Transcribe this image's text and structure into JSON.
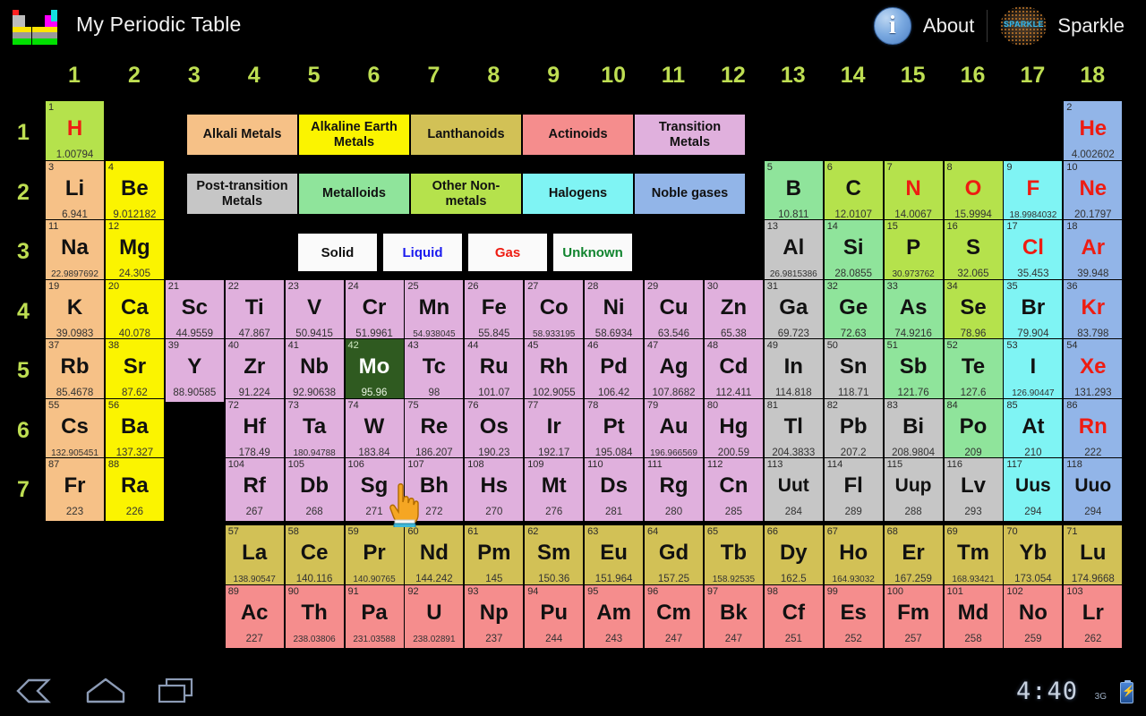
{
  "titlebar": {
    "app_title": "My Periodic Table",
    "about_label": "About",
    "sparkle_label": "Sparkle",
    "sparkle_mark": "SPARKLE",
    "info_icon": "info-icon"
  },
  "groups": [
    "1",
    "2",
    "3",
    "4",
    "5",
    "6",
    "7",
    "8",
    "9",
    "10",
    "11",
    "12",
    "13",
    "14",
    "15",
    "16",
    "17",
    "18"
  ],
  "periods": [
    "1",
    "2",
    "3",
    "4",
    "5",
    "6",
    "7"
  ],
  "colors": {
    "alkali_metals": "#f6c187",
    "alkaline_earth_metals": "#fbf400",
    "lanthanoids": "#d2c156",
    "actinoids": "#f58d8d",
    "transition_metals": "#e0b0dd",
    "post_transition_metals": "#c6c6c6",
    "metalloids": "#8fe49b",
    "other_nonmetals": "#b5e24c",
    "halogens": "#7ff4f4",
    "noble_gases": "#92b5e8",
    "selected": "#2f5a20",
    "gas_text": "#ee1c12",
    "liquid_text": "#1b1bef",
    "unknown_text": "#11842f",
    "solid_text": "#111111",
    "group_label": "#bede52",
    "background": "#000000"
  },
  "legend": {
    "categories": [
      {
        "label": "Alkali Metals",
        "key": "alkali_metals"
      },
      {
        "label": "Alkaline Earth Metals",
        "key": "alkaline_earth_metals"
      },
      {
        "label": "Lanthanoids",
        "key": "lanthanoids"
      },
      {
        "label": "Actinoids",
        "key": "actinoids"
      },
      {
        "label": "Transition Metals",
        "key": "transition_metals"
      },
      {
        "label": "Post-transition Metals",
        "key": "post_transition_metals"
      },
      {
        "label": "Metalloids",
        "key": "metalloids"
      },
      {
        "label": "Other Non-metals",
        "key": "other_nonmetals"
      },
      {
        "label": "Halogens",
        "key": "halogens"
      },
      {
        "label": "Noble gases",
        "key": "noble_gases"
      }
    ],
    "states": [
      {
        "label": "Solid",
        "color": "#111111"
      },
      {
        "label": "Liquid",
        "color": "#1b1bef"
      },
      {
        "label": "Gas",
        "color": "#ee1c12"
      },
      {
        "label": "Unknown",
        "color": "#11842f"
      }
    ]
  },
  "selected_element": "Mo",
  "elements": [
    {
      "n": "1",
      "s": "H",
      "m": "1.00794",
      "g": 1,
      "p": 1,
      "cat": "other_nonmetals",
      "st": "gas"
    },
    {
      "n": "2",
      "s": "He",
      "m": "4.002602",
      "g": 18,
      "p": 1,
      "cat": "noble_gases",
      "st": "gas"
    },
    {
      "n": "3",
      "s": "Li",
      "m": "6.941",
      "g": 1,
      "p": 2,
      "cat": "alkali_metals",
      "st": "solid"
    },
    {
      "n": "4",
      "s": "Be",
      "m": "9.012182",
      "g": 2,
      "p": 2,
      "cat": "alkaline_earth_metals",
      "st": "solid"
    },
    {
      "n": "5",
      "s": "B",
      "m": "10.811",
      "g": 13,
      "p": 2,
      "cat": "metalloids",
      "st": "solid"
    },
    {
      "n": "6",
      "s": "C",
      "m": "12.0107",
      "g": 14,
      "p": 2,
      "cat": "other_nonmetals",
      "st": "solid"
    },
    {
      "n": "7",
      "s": "N",
      "m": "14.0067",
      "g": 15,
      "p": 2,
      "cat": "other_nonmetals",
      "st": "gas"
    },
    {
      "n": "8",
      "s": "O",
      "m": "15.9994",
      "g": 16,
      "p": 2,
      "cat": "other_nonmetals",
      "st": "gas"
    },
    {
      "n": "9",
      "s": "F",
      "m": "18.9984032",
      "g": 17,
      "p": 2,
      "cat": "halogens",
      "st": "gas"
    },
    {
      "n": "10",
      "s": "Ne",
      "m": "20.1797",
      "g": 18,
      "p": 2,
      "cat": "noble_gases",
      "st": "gas"
    },
    {
      "n": "11",
      "s": "Na",
      "m": "22.9897692",
      "g": 1,
      "p": 3,
      "cat": "alkali_metals",
      "st": "solid"
    },
    {
      "n": "12",
      "s": "Mg",
      "m": "24.305",
      "g": 2,
      "p": 3,
      "cat": "alkaline_earth_metals",
      "st": "solid"
    },
    {
      "n": "13",
      "s": "Al",
      "m": "26.9815386",
      "g": 13,
      "p": 3,
      "cat": "post_transition_metals",
      "st": "solid"
    },
    {
      "n": "14",
      "s": "Si",
      "m": "28.0855",
      "g": 14,
      "p": 3,
      "cat": "metalloids",
      "st": "solid"
    },
    {
      "n": "15",
      "s": "P",
      "m": "30.973762",
      "g": 15,
      "p": 3,
      "cat": "other_nonmetals",
      "st": "solid"
    },
    {
      "n": "16",
      "s": "S",
      "m": "32.065",
      "g": 16,
      "p": 3,
      "cat": "other_nonmetals",
      "st": "solid"
    },
    {
      "n": "17",
      "s": "Cl",
      "m": "35.453",
      "g": 17,
      "p": 3,
      "cat": "halogens",
      "st": "gas"
    },
    {
      "n": "18",
      "s": "Ar",
      "m": "39.948",
      "g": 18,
      "p": 3,
      "cat": "noble_gases",
      "st": "gas"
    },
    {
      "n": "19",
      "s": "K",
      "m": "39.0983",
      "g": 1,
      "p": 4,
      "cat": "alkali_metals",
      "st": "solid"
    },
    {
      "n": "20",
      "s": "Ca",
      "m": "40.078",
      "g": 2,
      "p": 4,
      "cat": "alkaline_earth_metals",
      "st": "solid"
    },
    {
      "n": "21",
      "s": "Sc",
      "m": "44.9559",
      "g": 3,
      "p": 4,
      "cat": "transition_metals",
      "st": "solid"
    },
    {
      "n": "22",
      "s": "Ti",
      "m": "47.867",
      "g": 4,
      "p": 4,
      "cat": "transition_metals",
      "st": "solid"
    },
    {
      "n": "23",
      "s": "V",
      "m": "50.9415",
      "g": 5,
      "p": 4,
      "cat": "transition_metals",
      "st": "solid"
    },
    {
      "n": "24",
      "s": "Cr",
      "m": "51.9961",
      "g": 6,
      "p": 4,
      "cat": "transition_metals",
      "st": "solid"
    },
    {
      "n": "25",
      "s": "Mn",
      "m": "54.938045",
      "g": 7,
      "p": 4,
      "cat": "transition_metals",
      "st": "solid"
    },
    {
      "n": "26",
      "s": "Fe",
      "m": "55.845",
      "g": 8,
      "p": 4,
      "cat": "transition_metals",
      "st": "solid"
    },
    {
      "n": "27",
      "s": "Co",
      "m": "58.933195",
      "g": 9,
      "p": 4,
      "cat": "transition_metals",
      "st": "solid"
    },
    {
      "n": "28",
      "s": "Ni",
      "m": "58.6934",
      "g": 10,
      "p": 4,
      "cat": "transition_metals",
      "st": "solid"
    },
    {
      "n": "29",
      "s": "Cu",
      "m": "63.546",
      "g": 11,
      "p": 4,
      "cat": "transition_metals",
      "st": "solid"
    },
    {
      "n": "30",
      "s": "Zn",
      "m": "65.38",
      "g": 12,
      "p": 4,
      "cat": "transition_metals",
      "st": "solid"
    },
    {
      "n": "31",
      "s": "Ga",
      "m": "69.723",
      "g": 13,
      "p": 4,
      "cat": "post_transition_metals",
      "st": "solid"
    },
    {
      "n": "32",
      "s": "Ge",
      "m": "72.63",
      "g": 14,
      "p": 4,
      "cat": "metalloids",
      "st": "solid"
    },
    {
      "n": "33",
      "s": "As",
      "m": "74.9216",
      "g": 15,
      "p": 4,
      "cat": "metalloids",
      "st": "solid"
    },
    {
      "n": "34",
      "s": "Se",
      "m": "78.96",
      "g": 16,
      "p": 4,
      "cat": "other_nonmetals",
      "st": "solid"
    },
    {
      "n": "35",
      "s": "Br",
      "m": "79.904",
      "g": 17,
      "p": 4,
      "cat": "halogens",
      "st": "liquid"
    },
    {
      "n": "36",
      "s": "Kr",
      "m": "83.798",
      "g": 18,
      "p": 4,
      "cat": "noble_gases",
      "st": "gas"
    },
    {
      "n": "37",
      "s": "Rb",
      "m": "85.4678",
      "g": 1,
      "p": 5,
      "cat": "alkali_metals",
      "st": "solid"
    },
    {
      "n": "38",
      "s": "Sr",
      "m": "87.62",
      "g": 2,
      "p": 5,
      "cat": "alkaline_earth_metals",
      "st": "solid"
    },
    {
      "n": "39",
      "s": "Y",
      "m": "88.90585",
      "g": 3,
      "p": 5,
      "cat": "transition_metals",
      "st": "solid"
    },
    {
      "n": "40",
      "s": "Zr",
      "m": "91.224",
      "g": 4,
      "p": 5,
      "cat": "transition_metals",
      "st": "solid"
    },
    {
      "n": "41",
      "s": "Nb",
      "m": "92.90638",
      "g": 5,
      "p": 5,
      "cat": "transition_metals",
      "st": "solid"
    },
    {
      "n": "42",
      "s": "Mo",
      "m": "95.96",
      "g": 6,
      "p": 5,
      "cat": "transition_metals",
      "st": "solid",
      "selected": true
    },
    {
      "n": "43",
      "s": "Tc",
      "m": "98",
      "g": 7,
      "p": 5,
      "cat": "transition_metals",
      "st": "solid"
    },
    {
      "n": "44",
      "s": "Ru",
      "m": "101.07",
      "g": 8,
      "p": 5,
      "cat": "transition_metals",
      "st": "solid"
    },
    {
      "n": "45",
      "s": "Rh",
      "m": "102.9055",
      "g": 9,
      "p": 5,
      "cat": "transition_metals",
      "st": "solid"
    },
    {
      "n": "46",
      "s": "Pd",
      "m": "106.42",
      "g": 10,
      "p": 5,
      "cat": "transition_metals",
      "st": "solid"
    },
    {
      "n": "47",
      "s": "Ag",
      "m": "107.8682",
      "g": 11,
      "p": 5,
      "cat": "transition_metals",
      "st": "solid"
    },
    {
      "n": "48",
      "s": "Cd",
      "m": "112.411",
      "g": 12,
      "p": 5,
      "cat": "transition_metals",
      "st": "solid"
    },
    {
      "n": "49",
      "s": "In",
      "m": "114.818",
      "g": 13,
      "p": 5,
      "cat": "post_transition_metals",
      "st": "solid"
    },
    {
      "n": "50",
      "s": "Sn",
      "m": "118.71",
      "g": 14,
      "p": 5,
      "cat": "post_transition_metals",
      "st": "solid"
    },
    {
      "n": "51",
      "s": "Sb",
      "m": "121.76",
      "g": 15,
      "p": 5,
      "cat": "metalloids",
      "st": "solid"
    },
    {
      "n": "52",
      "s": "Te",
      "m": "127.6",
      "g": 16,
      "p": 5,
      "cat": "metalloids",
      "st": "solid"
    },
    {
      "n": "53",
      "s": "I",
      "m": "126.90447",
      "g": 17,
      "p": 5,
      "cat": "halogens",
      "st": "solid"
    },
    {
      "n": "54",
      "s": "Xe",
      "m": "131.293",
      "g": 18,
      "p": 5,
      "cat": "noble_gases",
      "st": "gas"
    },
    {
      "n": "55",
      "s": "Cs",
      "m": "132.905451",
      "g": 1,
      "p": 6,
      "cat": "alkali_metals",
      "st": "solid"
    },
    {
      "n": "56",
      "s": "Ba",
      "m": "137.327",
      "g": 2,
      "p": 6,
      "cat": "alkaline_earth_metals",
      "st": "solid"
    },
    {
      "n": "72",
      "s": "Hf",
      "m": "178.49",
      "g": 4,
      "p": 6,
      "cat": "transition_metals",
      "st": "solid"
    },
    {
      "n": "73",
      "s": "Ta",
      "m": "180.94788",
      "g": 5,
      "p": 6,
      "cat": "transition_metals",
      "st": "solid"
    },
    {
      "n": "74",
      "s": "W",
      "m": "183.84",
      "g": 6,
      "p": 6,
      "cat": "transition_metals",
      "st": "solid"
    },
    {
      "n": "75",
      "s": "Re",
      "m": "186.207",
      "g": 7,
      "p": 6,
      "cat": "transition_metals",
      "st": "solid"
    },
    {
      "n": "76",
      "s": "Os",
      "m": "190.23",
      "g": 8,
      "p": 6,
      "cat": "transition_metals",
      "st": "solid"
    },
    {
      "n": "77",
      "s": "Ir",
      "m": "192.17",
      "g": 9,
      "p": 6,
      "cat": "transition_metals",
      "st": "solid"
    },
    {
      "n": "78",
      "s": "Pt",
      "m": "195.084",
      "g": 10,
      "p": 6,
      "cat": "transition_metals",
      "st": "solid"
    },
    {
      "n": "79",
      "s": "Au",
      "m": "196.966569",
      "g": 11,
      "p": 6,
      "cat": "transition_metals",
      "st": "solid"
    },
    {
      "n": "80",
      "s": "Hg",
      "m": "200.59",
      "g": 12,
      "p": 6,
      "cat": "transition_metals",
      "st": "liquid"
    },
    {
      "n": "81",
      "s": "Tl",
      "m": "204.3833",
      "g": 13,
      "p": 6,
      "cat": "post_transition_metals",
      "st": "solid"
    },
    {
      "n": "82",
      "s": "Pb",
      "m": "207.2",
      "g": 14,
      "p": 6,
      "cat": "post_transition_metals",
      "st": "solid"
    },
    {
      "n": "83",
      "s": "Bi",
      "m": "208.9804",
      "g": 15,
      "p": 6,
      "cat": "post_transition_metals",
      "st": "solid"
    },
    {
      "n": "84",
      "s": "Po",
      "m": "209",
      "g": 16,
      "p": 6,
      "cat": "metalloids",
      "st": "solid"
    },
    {
      "n": "85",
      "s": "At",
      "m": "210",
      "g": 17,
      "p": 6,
      "cat": "halogens",
      "st": "solid"
    },
    {
      "n": "86",
      "s": "Rn",
      "m": "222",
      "g": 18,
      "p": 6,
      "cat": "noble_gases",
      "st": "gas"
    },
    {
      "n": "87",
      "s": "Fr",
      "m": "223",
      "g": 1,
      "p": 7,
      "cat": "alkali_metals",
      "st": "solid"
    },
    {
      "n": "88",
      "s": "Ra",
      "m": "226",
      "g": 2,
      "p": 7,
      "cat": "alkaline_earth_metals",
      "st": "solid"
    },
    {
      "n": "104",
      "s": "Rf",
      "m": "267",
      "g": 4,
      "p": 7,
      "cat": "transition_metals",
      "st": "unknown"
    },
    {
      "n": "105",
      "s": "Db",
      "m": "268",
      "g": 5,
      "p": 7,
      "cat": "transition_metals",
      "st": "unknown"
    },
    {
      "n": "106",
      "s": "Sg",
      "m": "271",
      "g": 6,
      "p": 7,
      "cat": "transition_metals",
      "st": "unknown"
    },
    {
      "n": "107",
      "s": "Bh",
      "m": "272",
      "g": 7,
      "p": 7,
      "cat": "transition_metals",
      "st": "unknown"
    },
    {
      "n": "108",
      "s": "Hs",
      "m": "270",
      "g": 8,
      "p": 7,
      "cat": "transition_metals",
      "st": "unknown"
    },
    {
      "n": "109",
      "s": "Mt",
      "m": "276",
      "g": 9,
      "p": 7,
      "cat": "transition_metals",
      "st": "unknown"
    },
    {
      "n": "110",
      "s": "Ds",
      "m": "281",
      "g": 10,
      "p": 7,
      "cat": "transition_metals",
      "st": "unknown"
    },
    {
      "n": "111",
      "s": "Rg",
      "m": "280",
      "g": 11,
      "p": 7,
      "cat": "transition_metals",
      "st": "unknown"
    },
    {
      "n": "112",
      "s": "Cn",
      "m": "285",
      "g": 12,
      "p": 7,
      "cat": "transition_metals",
      "st": "unknown"
    },
    {
      "n": "113",
      "s": "Uut",
      "m": "284",
      "g": 13,
      "p": 7,
      "cat": "post_transition_metals",
      "st": "unknown"
    },
    {
      "n": "114",
      "s": "Fl",
      "m": "289",
      "g": 14,
      "p": 7,
      "cat": "post_transition_metals",
      "st": "unknown"
    },
    {
      "n": "115",
      "s": "Uup",
      "m": "288",
      "g": 15,
      "p": 7,
      "cat": "post_transition_metals",
      "st": "unknown"
    },
    {
      "n": "116",
      "s": "Lv",
      "m": "293",
      "g": 16,
      "p": 7,
      "cat": "post_transition_metals",
      "st": "unknown"
    },
    {
      "n": "117",
      "s": "Uus",
      "m": "294",
      "g": 17,
      "p": 7,
      "cat": "halogens",
      "st": "unknown"
    },
    {
      "n": "118",
      "s": "Uuo",
      "m": "294",
      "g": 18,
      "p": 7,
      "cat": "noble_gases",
      "st": "unknown"
    }
  ],
  "lanthanoids": [
    {
      "n": "57",
      "s": "La",
      "m": "138.90547"
    },
    {
      "n": "58",
      "s": "Ce",
      "m": "140.116"
    },
    {
      "n": "59",
      "s": "Pr",
      "m": "140.90765"
    },
    {
      "n": "60",
      "s": "Nd",
      "m": "144.242"
    },
    {
      "n": "61",
      "s": "Pm",
      "m": "145"
    },
    {
      "n": "62",
      "s": "Sm",
      "m": "150.36"
    },
    {
      "n": "63",
      "s": "Eu",
      "m": "151.964"
    },
    {
      "n": "64",
      "s": "Gd",
      "m": "157.25"
    },
    {
      "n": "65",
      "s": "Tb",
      "m": "158.92535"
    },
    {
      "n": "66",
      "s": "Dy",
      "m": "162.5"
    },
    {
      "n": "67",
      "s": "Ho",
      "m": "164.93032"
    },
    {
      "n": "68",
      "s": "Er",
      "m": "167.259"
    },
    {
      "n": "69",
      "s": "Tm",
      "m": "168.93421"
    },
    {
      "n": "70",
      "s": "Yb",
      "m": "173.054"
    },
    {
      "n": "71",
      "s": "Lu",
      "m": "174.9668"
    }
  ],
  "actinoids": [
    {
      "n": "89",
      "s": "Ac",
      "m": "227"
    },
    {
      "n": "90",
      "s": "Th",
      "m": "238.03806"
    },
    {
      "n": "91",
      "s": "Pa",
      "m": "231.03588"
    },
    {
      "n": "92",
      "s": "U",
      "m": "238.02891"
    },
    {
      "n": "93",
      "s": "Np",
      "m": "237"
    },
    {
      "n": "94",
      "s": "Pu",
      "m": "244"
    },
    {
      "n": "95",
      "s": "Am",
      "m": "243"
    },
    {
      "n": "96",
      "s": "Cm",
      "m": "247"
    },
    {
      "n": "97",
      "s": "Bk",
      "m": "247"
    },
    {
      "n": "98",
      "s": "Cf",
      "m": "251"
    },
    {
      "n": "99",
      "s": "Es",
      "m": "252"
    },
    {
      "n": "100",
      "s": "Fm",
      "m": "257"
    },
    {
      "n": "101",
      "s": "Md",
      "m": "258"
    },
    {
      "n": "102",
      "s": "No",
      "m": "259"
    },
    {
      "n": "103",
      "s": "Lr",
      "m": "262"
    }
  ],
  "sysbar": {
    "back_icon": "back-icon",
    "home_icon": "home-icon",
    "recents_icon": "recents-icon",
    "clock": "4:40",
    "network": "3G",
    "battery_icon": "battery-charging-icon"
  }
}
